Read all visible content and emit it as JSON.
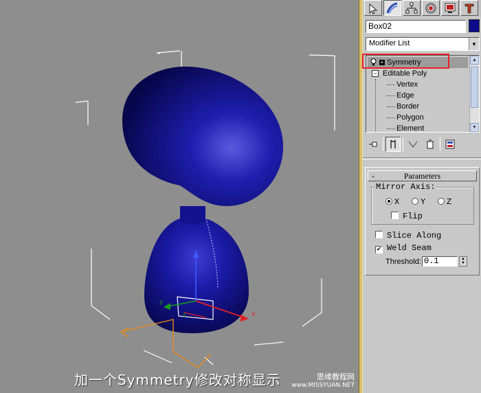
{
  "viewport": {
    "caption": "加一个Symmetry修改对称显示",
    "watermark_name": "思缘教程网",
    "watermark_url": "www.MISSYUAN.NET",
    "object_color": "#1a1a9e",
    "background_color": "#8e8e8e",
    "axis_labels": {
      "x": "x",
      "y": "y",
      "z": "z"
    }
  },
  "panel": {
    "tabs": [
      {
        "icon": "create-icon",
        "active": false
      },
      {
        "icon": "modify-icon",
        "active": true
      },
      {
        "icon": "hierarchy-icon",
        "active": false
      },
      {
        "icon": "motion-icon",
        "active": false
      },
      {
        "icon": "display-icon",
        "active": false
      },
      {
        "icon": "utilities-icon",
        "active": false
      }
    ],
    "object_name": "Box02",
    "object_color": "#0b0b8a",
    "modifier_list_label": "Modifier List",
    "stack": {
      "top_modifier": "Symmetry",
      "base_object": "Editable Poly",
      "sub_objects": [
        "Vertex",
        "Edge",
        "Border",
        "Polygon",
        "Element"
      ]
    },
    "highlight_color": "#e8202a"
  },
  "parameters": {
    "title": "Parameters",
    "collapse_symbol": "-",
    "mirror_axis_label": "Mirror Axis:",
    "axes": [
      {
        "label": "X",
        "selected": true
      },
      {
        "label": "Y",
        "selected": false
      },
      {
        "label": "Z",
        "selected": false
      }
    ],
    "flip_label": "Flip",
    "flip_checked": false,
    "slice_along_label": "Slice Along",
    "slice_along_checked": false,
    "weld_seam_label": "Weld Seam",
    "weld_seam_checked": true,
    "threshold_label": "Threshold:",
    "threshold_value": "0.1"
  }
}
